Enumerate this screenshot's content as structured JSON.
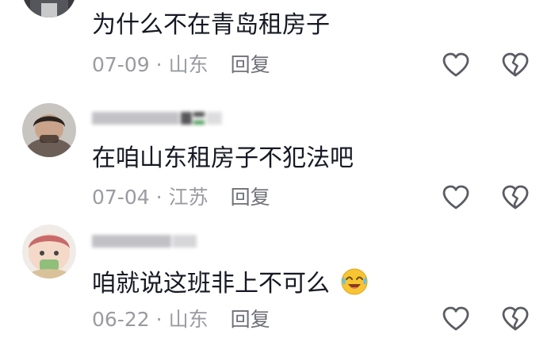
{
  "comments": [
    {
      "text": "为什么不在青岛租房子",
      "date": "07-09",
      "separator": "·",
      "location": "山东",
      "reply_label": "回复"
    },
    {
      "text": "在咱山东租房子不犯法吧",
      "date": "07-04",
      "separator": "·",
      "location": "江苏",
      "reply_label": "回复"
    },
    {
      "text": "咱就说这班非上不可么",
      "emoji": "crying-laughing-face",
      "date": "06-22",
      "separator": "·",
      "location": "山东",
      "reply_label": "回复"
    }
  ],
  "icons": {
    "like": "heart-outline-icon",
    "dislike": "broken-heart-icon"
  },
  "colors": {
    "text": "#161823",
    "meta": "#9a9ba1",
    "reply": "#6f7077",
    "icon": "#5b5c63"
  }
}
